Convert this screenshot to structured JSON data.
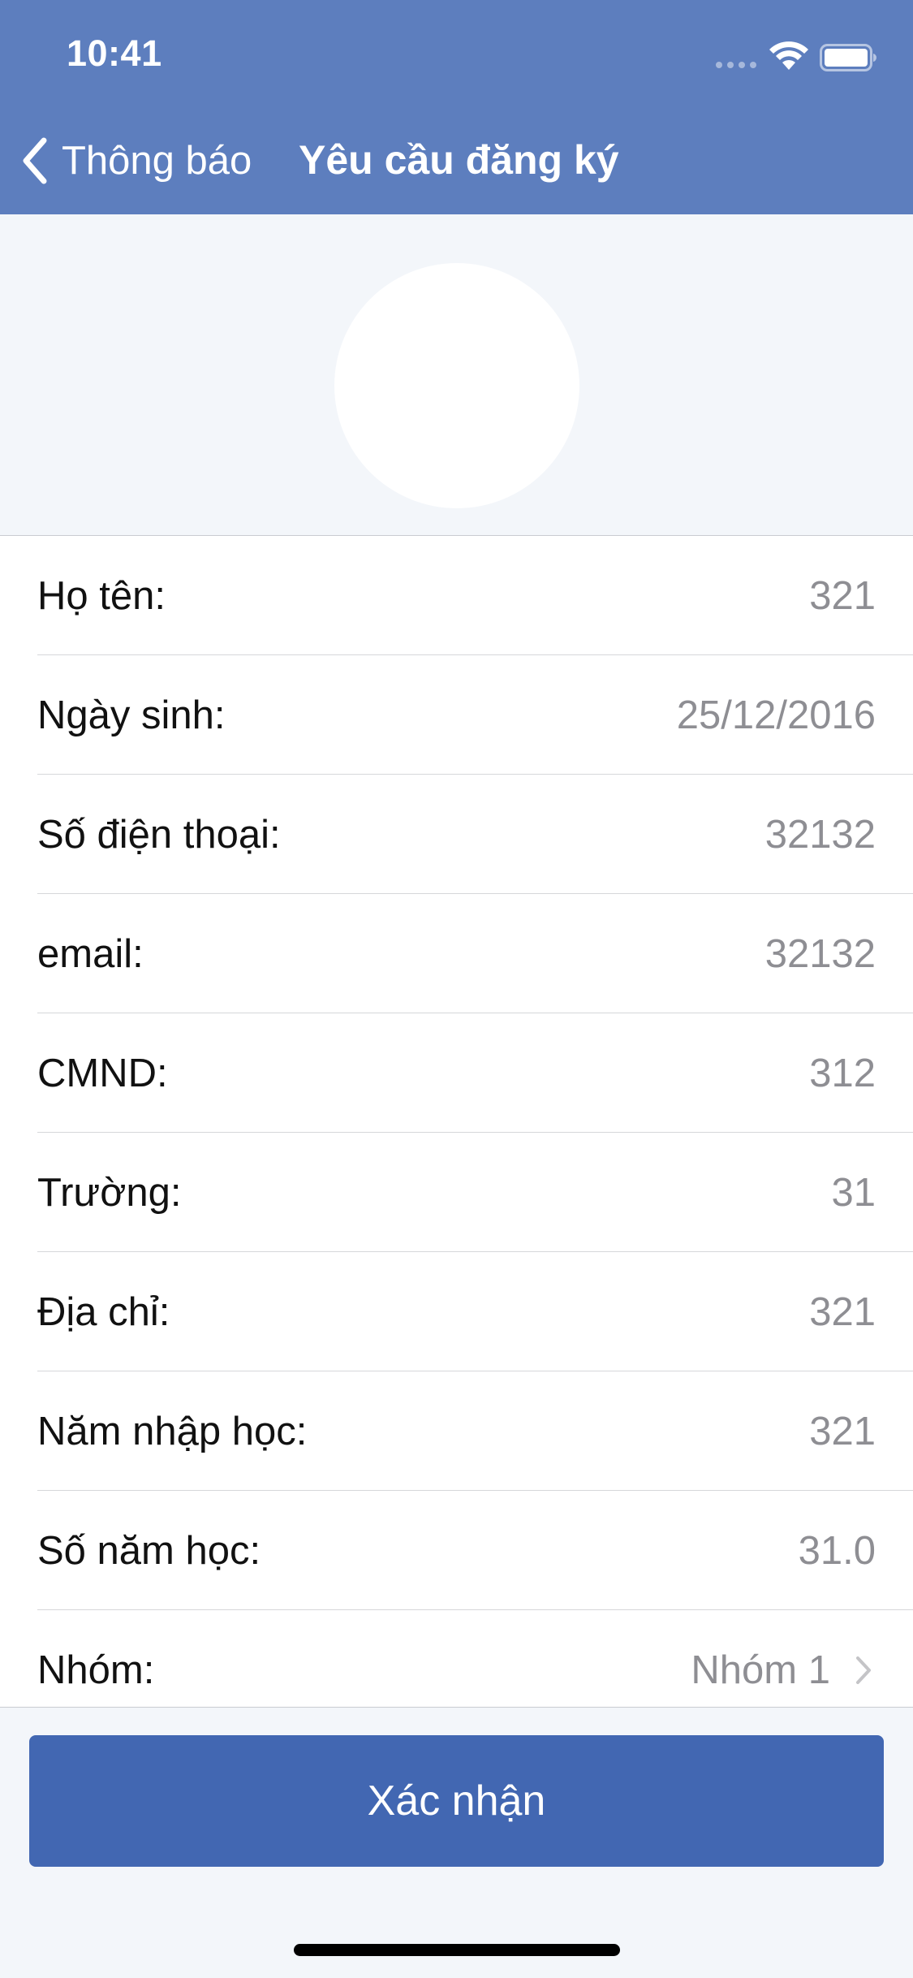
{
  "status_bar": {
    "time": "10:41"
  },
  "nav": {
    "back_label": "Thông báo",
    "title": "Yêu cầu đăng ký"
  },
  "form": {
    "rows": [
      {
        "label": "Họ tên:",
        "value": "321"
      },
      {
        "label": "Ngày sinh:",
        "value": "25/12/2016"
      },
      {
        "label": "Số điện thoại:",
        "value": "32132"
      },
      {
        "label": "email:",
        "value": "32132"
      },
      {
        "label": "CMND:",
        "value": "312"
      },
      {
        "label": "Trường:",
        "value": "31"
      },
      {
        "label": "Địa chỉ:",
        "value": "321"
      },
      {
        "label": "Năm nhập học:",
        "value": "321"
      },
      {
        "label": "Số năm học:",
        "value": "31.0"
      },
      {
        "label": "Nhóm:",
        "value": "Nhóm 1"
      }
    ]
  },
  "actions": {
    "confirm_label": "Xác nhận"
  },
  "icons": {
    "back": "chevron-left-icon",
    "disclosure": "chevron-right-icon",
    "signal": "cellular-signal-icon",
    "wifi": "wifi-icon",
    "battery": "battery-icon"
  },
  "colors": {
    "header_background": "#5d7ebe",
    "page_background": "#f3f6fa",
    "button_background": "#4267b2",
    "value_text": "#8e8e93",
    "label_text": "#111111"
  }
}
